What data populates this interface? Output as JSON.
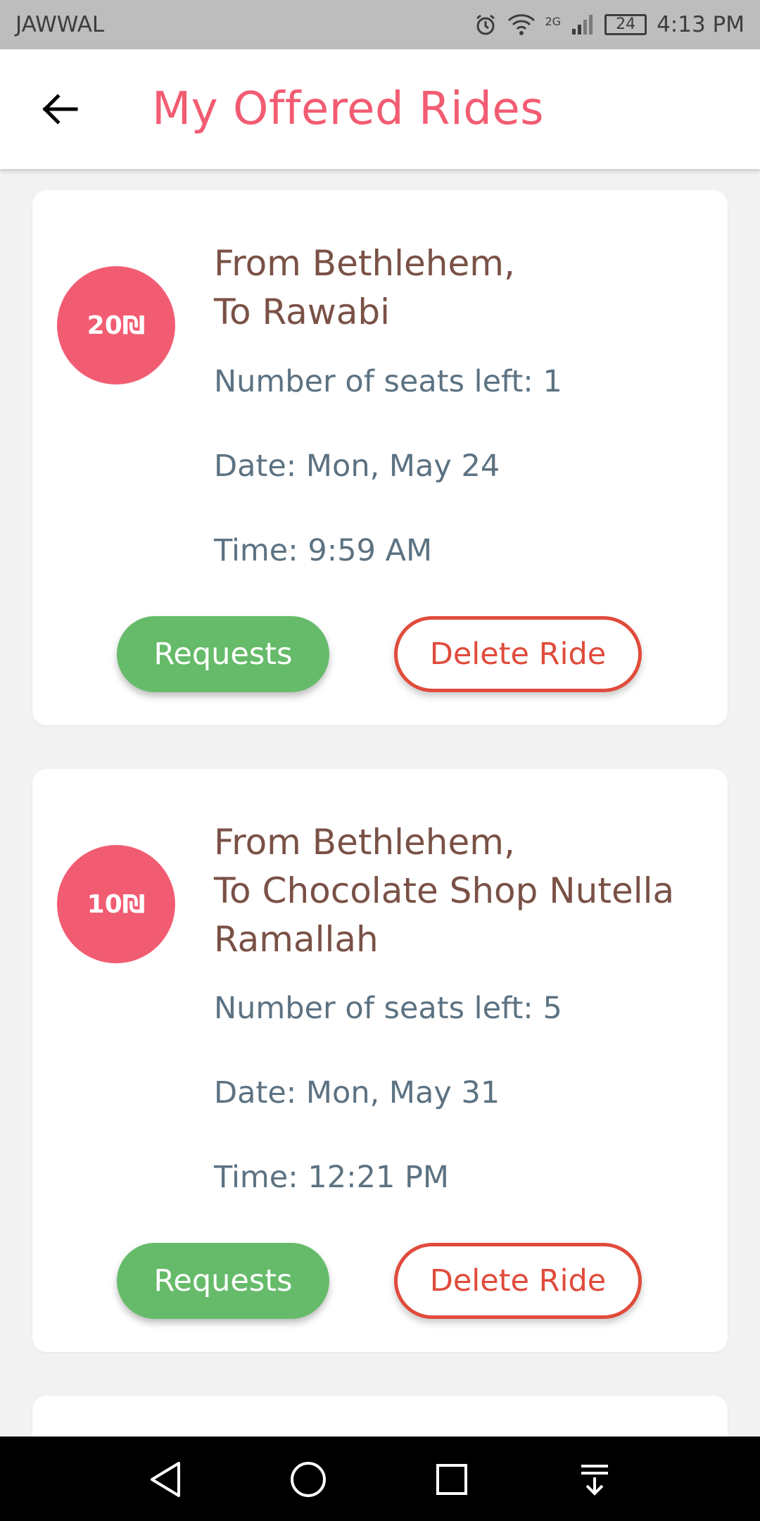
{
  "status_bar": {
    "carrier": "JAWWAL",
    "network": "2G",
    "battery": "24",
    "time": "4:13 PM"
  },
  "header": {
    "title": "My Offered Rides",
    "back_icon": "arrow-left-icon"
  },
  "rides": [
    {
      "price": "20₪",
      "route_line1": "From Bethlehem,",
      "route_line2": "To Rawabi",
      "seats": "Number of seats left: 1",
      "date": "Date: Mon, May 24",
      "time": "Time: 9:59 AM",
      "requests_label": "Requests",
      "delete_label": "Delete Ride"
    },
    {
      "price": "10₪",
      "route_line1": "From Bethlehem,",
      "route_line2": "To Chocolate Shop Nutella Ramallah",
      "seats": "Number of seats left: 5",
      "date": "Date: Mon, May 31",
      "time": "Time: 12:21 PM",
      "requests_label": "Requests",
      "delete_label": "Delete Ride"
    }
  ],
  "colors": {
    "accent": "#f25c72",
    "requests": "#66bb6a",
    "delete": "#e04b3b",
    "route_text": "#7a5146",
    "info_text": "#5c7282"
  },
  "nav_bar": {
    "icons": [
      "back-triangle-icon",
      "home-circle-icon",
      "recents-square-icon",
      "notification-pull-icon"
    ]
  }
}
